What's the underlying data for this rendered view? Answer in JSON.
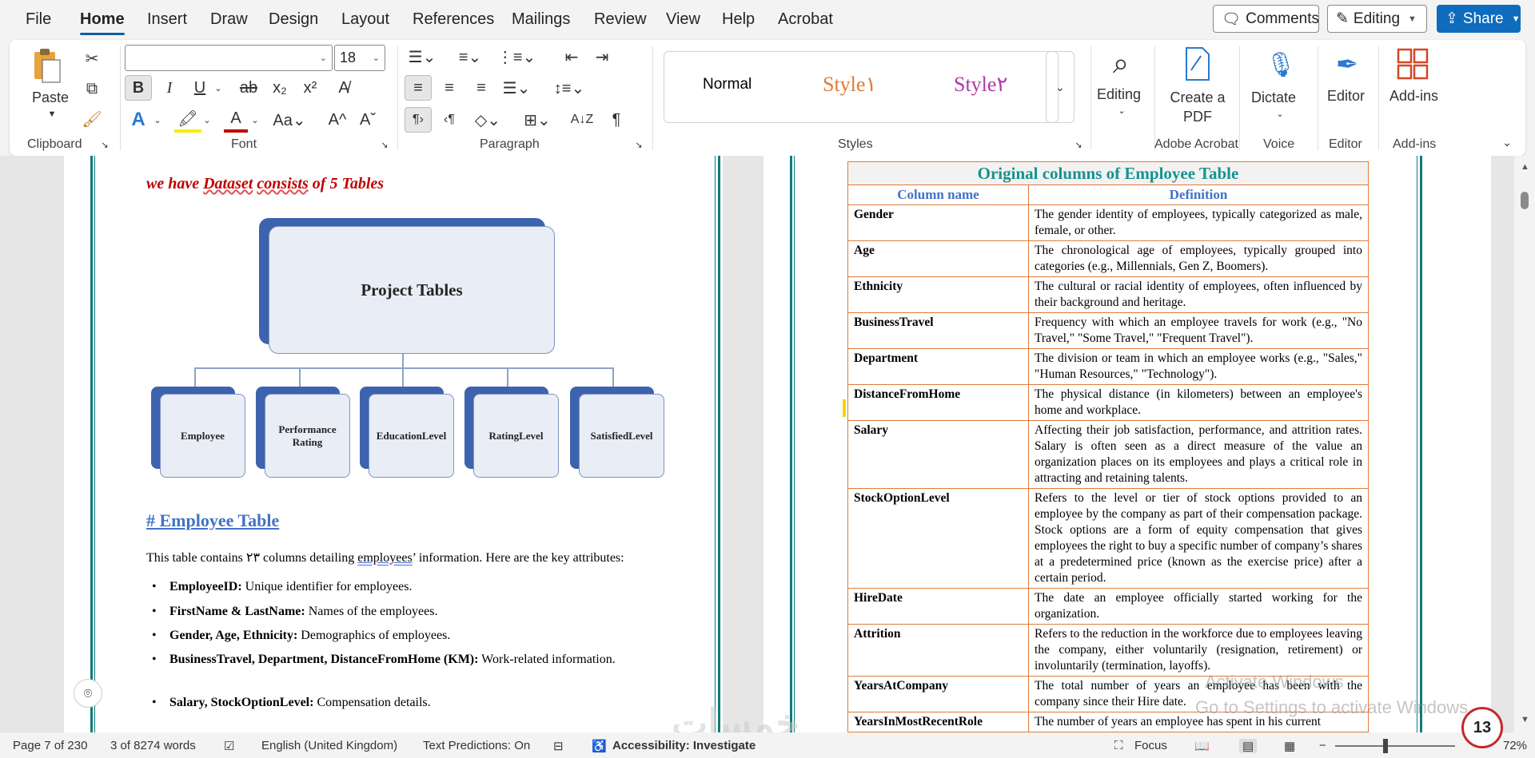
{
  "menu": {
    "tabs": [
      "File",
      "Home",
      "Insert",
      "Draw",
      "Design",
      "Layout",
      "References",
      "Mailings",
      "Review",
      "View",
      "Help",
      "Acrobat"
    ],
    "active_tab": "Home",
    "comments_label": "Comments",
    "editing_label": "Editing",
    "share_label": "Share"
  },
  "ribbon": {
    "clipboard": {
      "paste_label": "Paste",
      "group_label": "Clipboard"
    },
    "font": {
      "font_name": "",
      "font_size": "18",
      "group_label": "Font"
    },
    "paragraph": {
      "group_label": "Paragraph"
    },
    "styles": {
      "items": [
        "Normal",
        "Style١",
        "Style٢"
      ],
      "group_label": "Styles"
    },
    "editing": {
      "label": "Editing"
    },
    "acrobat": {
      "label": "Create a PDF",
      "group_label": "Adobe Acrobat"
    },
    "voice": {
      "label": "Dictate",
      "group_label": "Voice"
    },
    "editor": {
      "label": "Editor",
      "group_label": "Editor"
    },
    "addins": {
      "label": "Add-ins",
      "group_label": "Add-ins"
    }
  },
  "left_page": {
    "intro_parts": [
      "we have ",
      "Dataset",
      " ",
      "consists",
      " of 5 Tables"
    ],
    "chart_root": "Project Tables",
    "chart_children": [
      "Employee",
      "Performance Rating",
      "EducationLevel",
      "RatingLevel",
      "SatisfiedLevel"
    ],
    "heading": "# Employee Table",
    "desc_parts": [
      "This table contains ٢٣ columns detailing ",
      "employees",
      "’ information. Here are the key attributes:"
    ],
    "bullets": [
      {
        "key": "EmployeeID:",
        "text": " Unique identifier for employees."
      },
      {
        "key": "FirstName & LastName:",
        "text": " Names of the employees."
      },
      {
        "key": "Gender, Age, Ethnicity:",
        "text": " Demographics of employees."
      },
      {
        "key": "BusinessTravel, Department, DistanceFromHome (KM):",
        "text": " Work-related information."
      },
      {
        "key": "Salary, StockOptionLevel:",
        "text": " Compensation details."
      }
    ]
  },
  "right_page": {
    "table_title": "Original columns of Employee Table",
    "col_headers": [
      "Column name",
      "Definition"
    ],
    "rows": [
      {
        "name": "Gender",
        "def": "The gender identity of employees, typically categorized as male, female, or other."
      },
      {
        "name": "Age",
        "def": "The chronological age of employees, typically grouped into categories (e.g., Millennials, Gen Z, Boomers)."
      },
      {
        "name": "Ethnicity",
        "def": "The cultural or racial identity of employees, often influenced by their background and heritage."
      },
      {
        "name": "BusinessTravel",
        "def": "Frequency with which an employee travels for work (e.g., \"No Travel,\" \"Some Travel,\" \"Frequent Travel\")."
      },
      {
        "name": "Department",
        "def": "The division or team in which an employee works (e.g., \"Sales,\" \"Human Resources,\" \"Technology\")."
      },
      {
        "name": "DistanceFromHome",
        "def": "The physical distance (in kilometers) between an employee's home and workplace."
      },
      {
        "name": "Salary",
        "def": "Affecting their job satisfaction, performance, and attrition rates. Salary is often seen as a direct measure of the value an organization places on its employees and plays a critical role in attracting and retaining talents."
      },
      {
        "name": "StockOptionLevel",
        "def": "Refers to the level or tier of stock options provided to an employee by the company as part of their compensation package. Stock options are a form of equity compensation that gives employees the right to buy a specific number of company’s shares at a predetermined price (known as the exercise price) after a certain period."
      },
      {
        "name": "HireDate",
        "def": "The date an employee officially started working for the organization."
      },
      {
        "name": "Attrition",
        "def": "Refers to the reduction in the workforce due to employees leaving the company, either voluntarily (resignation, retirement) or involuntarily (termination, layoffs)."
      },
      {
        "name": "YearsAtCompany",
        "def": "The total number of years an employee has been with the company since their Hire date."
      },
      {
        "name": "YearsInMostRecentRole",
        "def": "The number of years an employee has spent in his current"
      }
    ]
  },
  "status": {
    "page": "Page 7 of 230",
    "words": "3 of 8274 words",
    "language": "English (United Kingdom)",
    "predictions": "Text Predictions: On",
    "accessibility": "Accessibility: Investigate",
    "focus": "Focus",
    "zoom": "72%"
  },
  "overlay": {
    "activate_line1": "Activate Windows",
    "activate_line2": "Go to Settings to activate Windows.",
    "badge_count": "13",
    "logo_text": "خمسات"
  }
}
